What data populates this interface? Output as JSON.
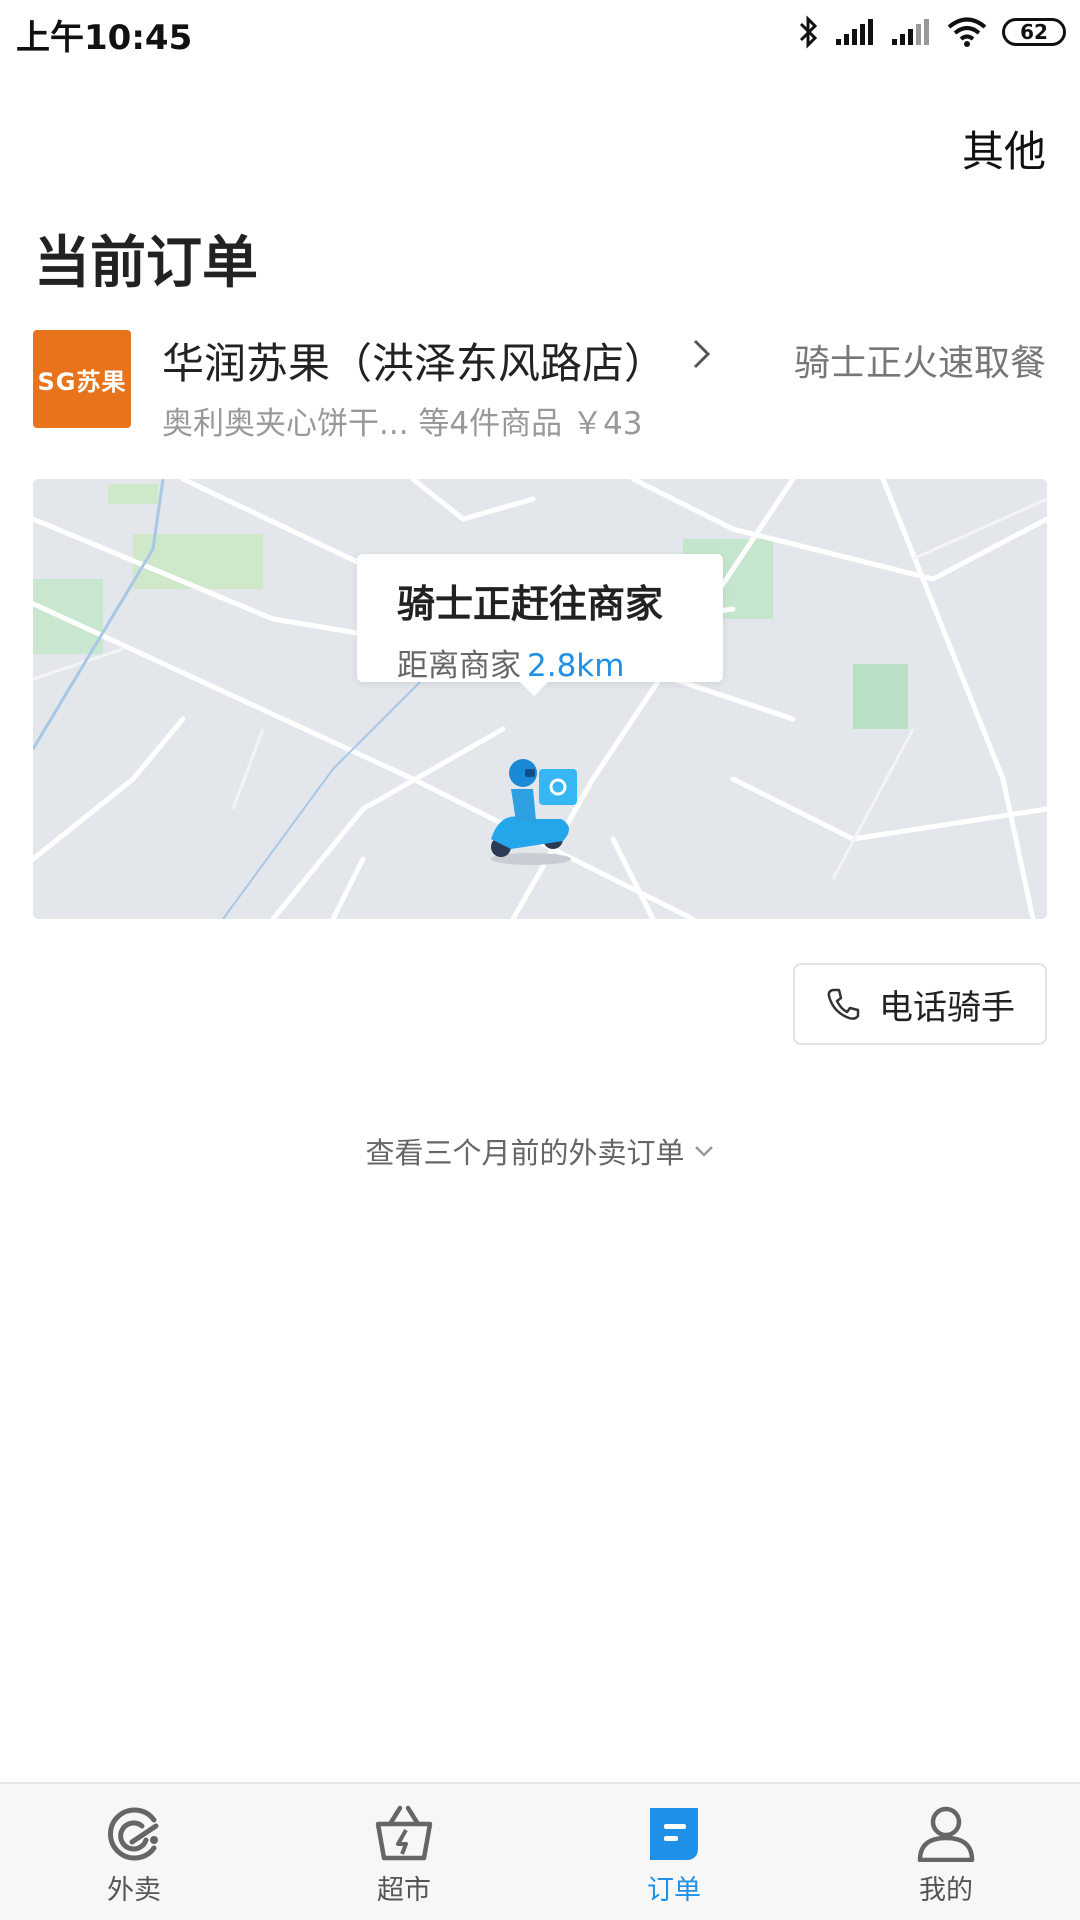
{
  "status_bar": {
    "time": "上午10:45",
    "battery": "62"
  },
  "header": {
    "more_label": "其他",
    "title": "当前订单"
  },
  "order": {
    "store_logo_text": "SG苏果",
    "store_name": "华润苏果（洪泽东风路店）",
    "status": "骑士正火速取餐",
    "summary": "奥利奥夹心饼干... 等4件商品 ￥43"
  },
  "map": {
    "popup_title": "骑士正赶往商家",
    "popup_distance_label": "距离商家",
    "popup_distance_value": "2.8km"
  },
  "call_button": {
    "label": "电话骑手"
  },
  "history_link": {
    "label": "查看三个月前的外卖订单"
  },
  "bottom_nav": {
    "items": [
      {
        "label": "外卖",
        "icon": "takeout-icon"
      },
      {
        "label": "超市",
        "icon": "basket-icon"
      },
      {
        "label": "订单",
        "icon": "order-icon",
        "active": true
      },
      {
        "label": "我的",
        "icon": "profile-icon"
      }
    ]
  },
  "colors": {
    "accent": "#1e90e8",
    "store_logo_bg": "#e8731a"
  }
}
